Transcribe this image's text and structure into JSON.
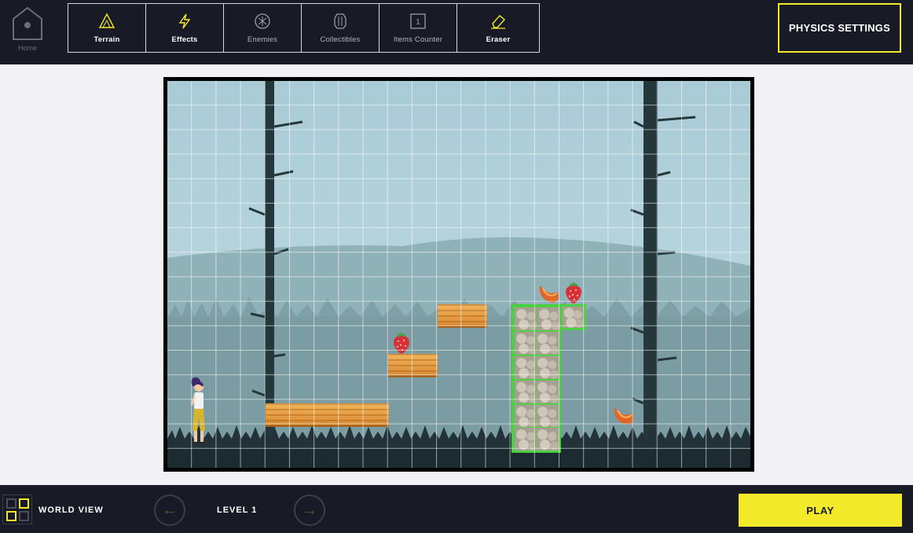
{
  "header": {
    "home_label": "Home",
    "tools": [
      {
        "label": "Terrain",
        "icon": "terrain-icon"
      },
      {
        "label": "Effects",
        "icon": "lightning-icon"
      },
      {
        "label": "Enemies",
        "icon": "enemy-icon"
      },
      {
        "label": "Collectibles",
        "icon": "gem-icon"
      },
      {
        "label": "Items Counter",
        "icon": "counter-icon",
        "icon_text": "1"
      },
      {
        "label": "Eraser",
        "icon": "eraser-icon"
      }
    ],
    "physics_settings_label": "PHYSICS SETTINGS"
  },
  "footer": {
    "world_view_label": "WORLD VIEW",
    "prev_icon": "arrow-left-icon",
    "next_icon": "arrow-right-icon",
    "level_label": "LEVEL 1",
    "play_label": "PLAY"
  },
  "colors": {
    "bar_background": "#181b25",
    "accent": "#f3ea2b",
    "stage_sky": "#aacdd8",
    "platform_wood": "#e9a446",
    "stone_highlight": "#47d13c"
  }
}
